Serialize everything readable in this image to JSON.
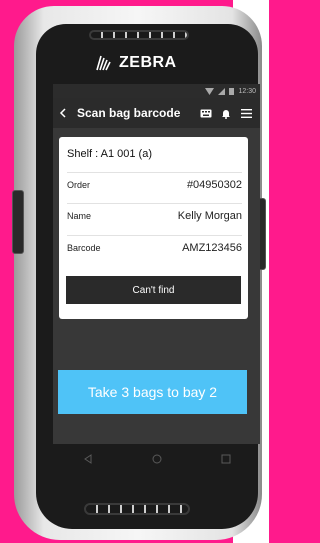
{
  "brand": {
    "name": "ZEBRA"
  },
  "status": {
    "time": "12:30"
  },
  "appbar": {
    "title": "Scan bag barcode",
    "back_icon": "chevron-left-icon",
    "icons": [
      "keyboard-icon",
      "bell-icon",
      "menu-icon"
    ]
  },
  "card": {
    "shelf": "Shelf : A1 001 (a)",
    "rows": [
      {
        "label": "Order",
        "value": "#04950302"
      },
      {
        "label": "Name",
        "value": "Kelly Morgan"
      },
      {
        "label": "Barcode",
        "value": "AMZ123456"
      }
    ],
    "cant_find_label": "Can't find"
  },
  "cta": {
    "label": "Take 3 bags to bay 2"
  },
  "colors": {
    "accent": "#4fc3f7",
    "background": "#ff1a8c",
    "screen": "#383838"
  }
}
